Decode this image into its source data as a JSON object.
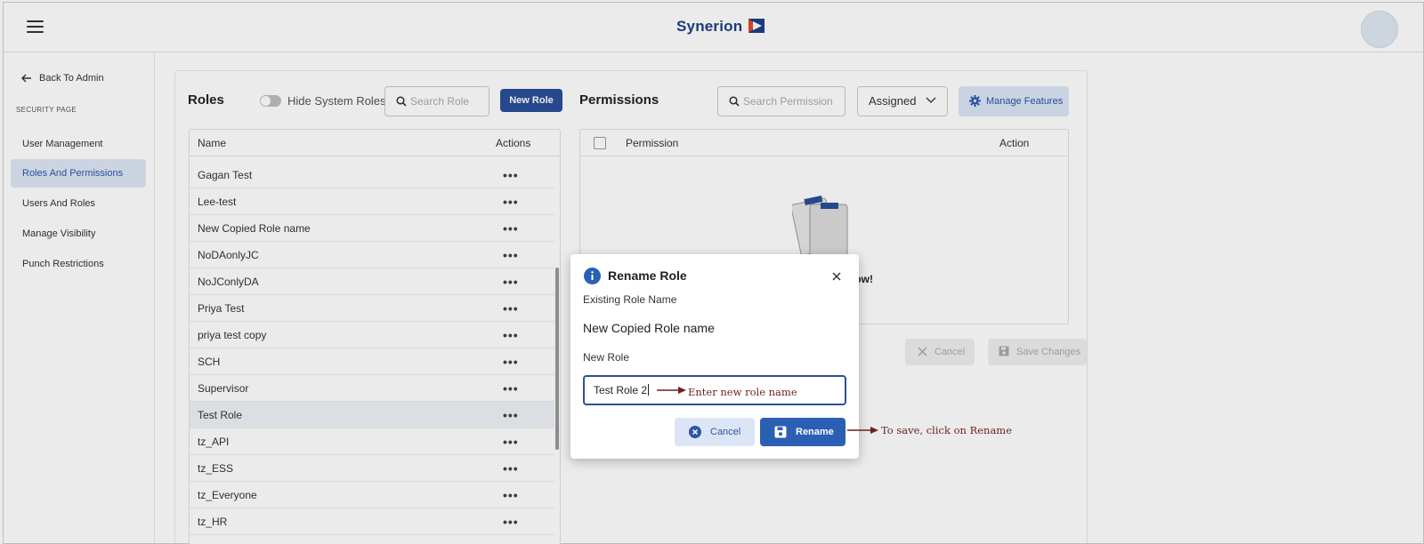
{
  "header": {
    "logo_text": "Synerion"
  },
  "sidebar": {
    "back_label": "Back To Admin",
    "section_label": "SECURITY PAGE",
    "items": [
      {
        "label": "User Management",
        "active": false
      },
      {
        "label": "Roles And Permissions",
        "active": true
      },
      {
        "label": "Users And Roles",
        "active": false
      },
      {
        "label": "Manage Visibility",
        "active": false
      },
      {
        "label": "Punch Restrictions",
        "active": false
      }
    ]
  },
  "roles": {
    "title": "Roles",
    "toggle_label": "Hide System Roles",
    "search_placeholder": "Search Role",
    "new_role_label": "New Role",
    "columns": [
      "Name",
      "Actions"
    ],
    "rows": [
      "Gagan Test",
      "Lee-test",
      "New Copied Role name",
      "NoDAonlyJC",
      "NoJConlyDA",
      "Priya Test",
      "priya test copy",
      "SCH",
      "Supervisor",
      "Test Role",
      "tz_API",
      "tz_ESS",
      "tz_Everyone",
      "tz_HR"
    ],
    "selected_row": "Test Role"
  },
  "permissions": {
    "title": "Permissions",
    "search_placeholder": "Search Permission",
    "filter_value": "Assigned",
    "manage_features_label": "Manage Features",
    "columns": [
      "Permission",
      "Action"
    ],
    "empty_text_visible": "now!",
    "cancel_label": "Cancel",
    "save_label": "Save Changes"
  },
  "dialog": {
    "title": "Rename Role",
    "existing_label": "Existing Role Name",
    "existing_value": "New Copied Role name",
    "new_label": "New Role",
    "input_value": "Test Role 2",
    "cancel_label": "Cancel",
    "rename_label": "Rename"
  },
  "annotations": {
    "input_hint": "Enter new role name",
    "save_hint": "To save, click on Rename"
  },
  "colors": {
    "brand_blue": "#2b4f9a",
    "active_nav_bg": "#dfe7f5",
    "annotation": "#6d1f1f"
  }
}
